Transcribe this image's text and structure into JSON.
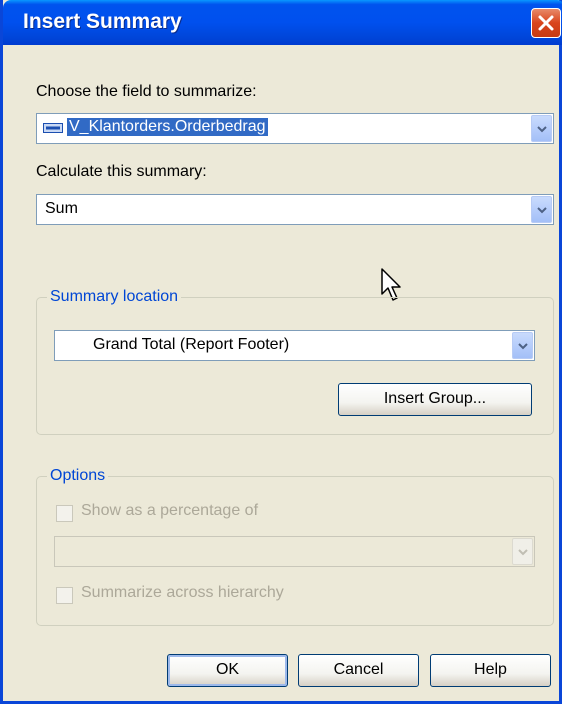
{
  "dialog": {
    "title": "Insert Summary"
  },
  "field": {
    "label": "Choose the field to summarize:",
    "value": "V_Klantorders.Orderbedrag"
  },
  "calc": {
    "label": "Calculate this summary:",
    "value": "Sum"
  },
  "location": {
    "legend": "Summary location",
    "value": "Grand Total (Report Footer)",
    "insert_group_label": "Insert Group..."
  },
  "options": {
    "legend": "Options",
    "percentage_label": "Show as a percentage of",
    "percentage_value": "",
    "hierarchy_label": "Summarize across hierarchy"
  },
  "buttons": {
    "ok": "OK",
    "cancel": "Cancel",
    "help": "Help"
  },
  "colors": {
    "titlebar": "#0053ee",
    "selection": "#316ac5",
    "legend": "#0046d5",
    "close": "#d9451c"
  }
}
